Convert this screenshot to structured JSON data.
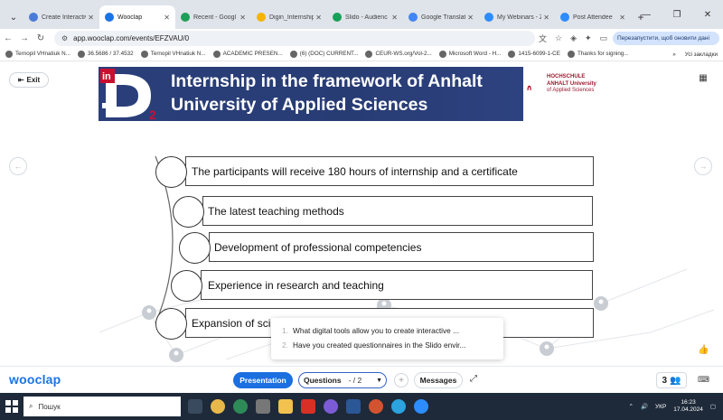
{
  "browser": {
    "tabs": [
      {
        "label": "Create Interactiv",
        "color": "#4a7bd8",
        "active": false
      },
      {
        "label": "Wooclap",
        "color": "#1b74e4",
        "active": true
      },
      {
        "label": "Recent - Googl",
        "color": "#1e9e57",
        "active": false
      },
      {
        "label": "Digin_Internship",
        "color": "#f4b400",
        "active": false
      },
      {
        "label": "Slido - Audienc",
        "color": "#18a058",
        "active": false
      },
      {
        "label": "Google Translate",
        "color": "#4285f4",
        "active": false
      },
      {
        "label": "My Webinars - Z",
        "color": "#2d8cff",
        "active": false
      },
      {
        "label": "Post Attendee",
        "color": "#2d8cff",
        "active": false
      }
    ],
    "url": "app.wooclap.com/events/EFZVAU/0",
    "relaunch_label": "Перезапустити, щоб оновити дані",
    "bookmarks": [
      "Ternopil VHnatiuk N...",
      "36.5686 / 37.4532",
      "Ternopil VHnatiuk N...",
      "ACADEMIC PRESEN...",
      "(6) (DOC) CURRENT...",
      "CEUR-WS.org/Vol-2...",
      "Microsoft Word - H...",
      "1415-6099-1-CE",
      "Thanks for signing..."
    ],
    "bookmarks_all": "Усі закладки"
  },
  "wooclap": {
    "exit_label": "Exit",
    "banner": {
      "line1": "Internship in the framework of Anhalt",
      "line2": "University of Applied Sciences",
      "logo_in": "in",
      "logo_sub": "2"
    },
    "university": {
      "line1": "HOCHSCHULE",
      "line2": "ANHALT University",
      "line3": "of Applied Sciences"
    },
    "items": [
      "The participants will receive 180 hours of internship and a certificate",
      "The latest teaching methods",
      "Development of professional competencies",
      "Experience in research and teaching",
      "Expansion of sci"
    ],
    "questions_popup": [
      {
        "num": "1.",
        "text": "What digital tools allow you to create interactive ..."
      },
      {
        "num": "2.",
        "text": "Have you created questionnaires in the Slido envir..."
      }
    ],
    "bottom": {
      "logo": "wooclap",
      "presentation": "Presentation",
      "questions": "Questions",
      "page": "- / 2",
      "messages": "Messages",
      "participants": "3"
    }
  },
  "taskbar": {
    "search_placeholder": "Пошук",
    "lang": "УКР",
    "time": "16:23",
    "date": "17.04.2024"
  }
}
